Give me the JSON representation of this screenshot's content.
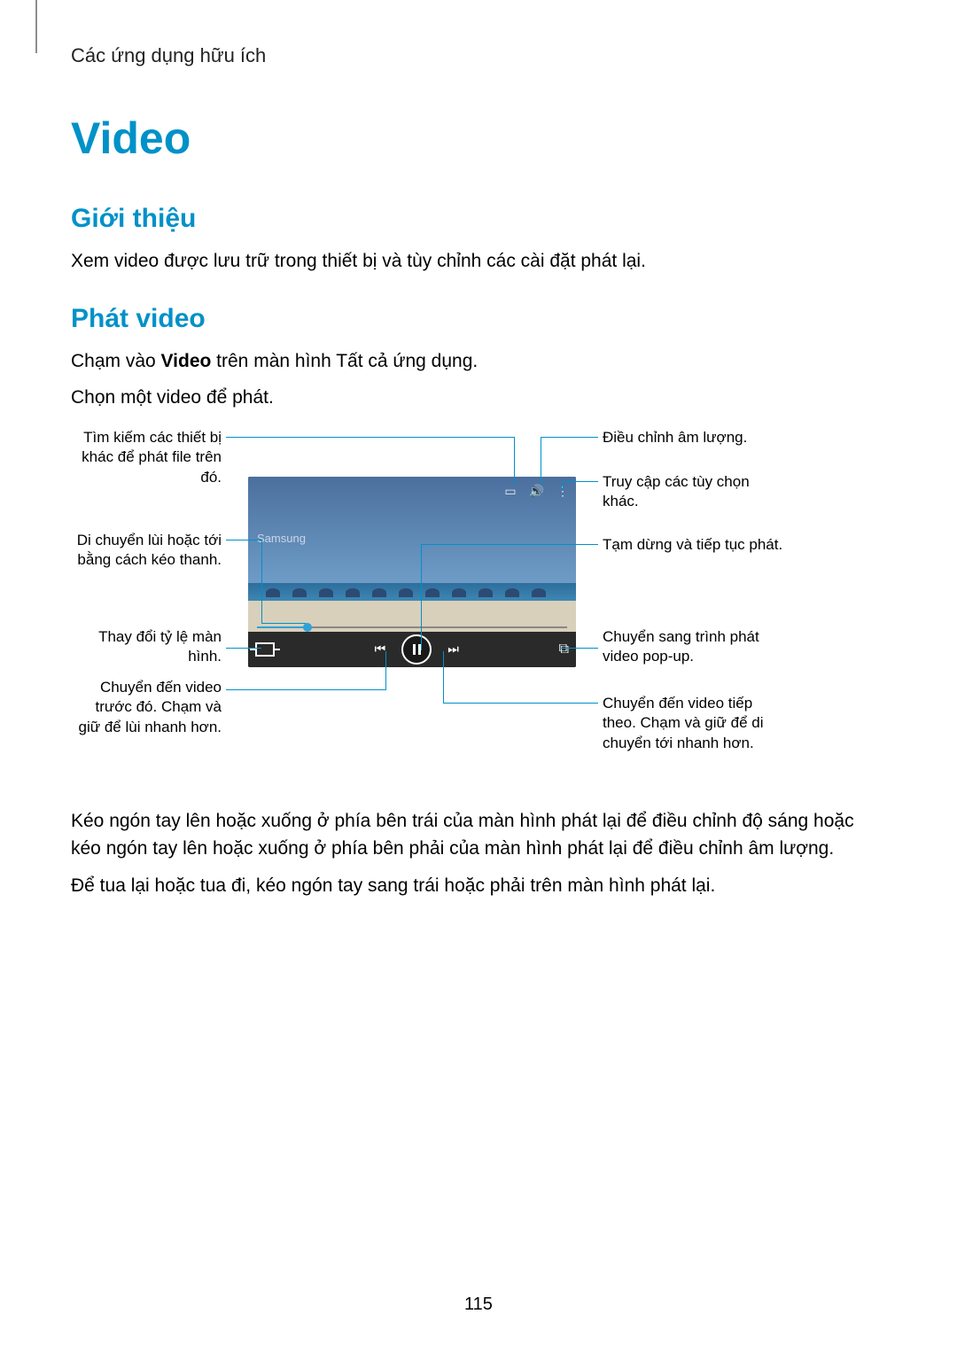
{
  "breadcrumb": "Các ứng dụng hữu ích",
  "page_title": "Video",
  "section_intro": {
    "heading": "Giới thiệu",
    "paragraph": "Xem video được lưu trữ trong thiết bị và tùy chỉnh các cài đặt phát lại."
  },
  "section_play": {
    "heading": "Phát video",
    "para1_pre": "Chạm vào ",
    "para1_bold": "Video",
    "para1_post": " trên màn hình Tất cả ứng dụng.",
    "para2": "Chọn một video để phát."
  },
  "figure": {
    "brand_text": "Samsung",
    "callouts_left": [
      "Tìm kiếm các thiết bị khác để phát file trên đó.",
      "Di chuyển lùi hoặc tới bằng cách kéo thanh.",
      "Thay đổi tỷ lệ màn hình.",
      "Chuyển đến video trước đó. Chạm và giữ để lùi nhanh hơn."
    ],
    "callouts_right": [
      "Điều chỉnh âm lượng.",
      "Truy cập các tùy chọn khác.",
      "Tạm dừng và tiếp tục phát.",
      "Chuyển sang trình phát video pop-up.",
      "Chuyển đến video tiếp theo. Chạm và giữ để di chuyển tới nhanh hơn."
    ]
  },
  "after_figure": {
    "p1": "Kéo ngón tay lên hoặc xuống ở phía bên trái của màn hình phát lại để điều chỉnh độ sáng hoặc kéo ngón tay lên hoặc xuống ở phía bên phải của màn hình phát lại để điều chỉnh âm lượng.",
    "p2": "Để tua lại hoặc tua đi, kéo ngón tay sang trái hoặc phải trên màn hình phát lại."
  },
  "page_number": "115"
}
